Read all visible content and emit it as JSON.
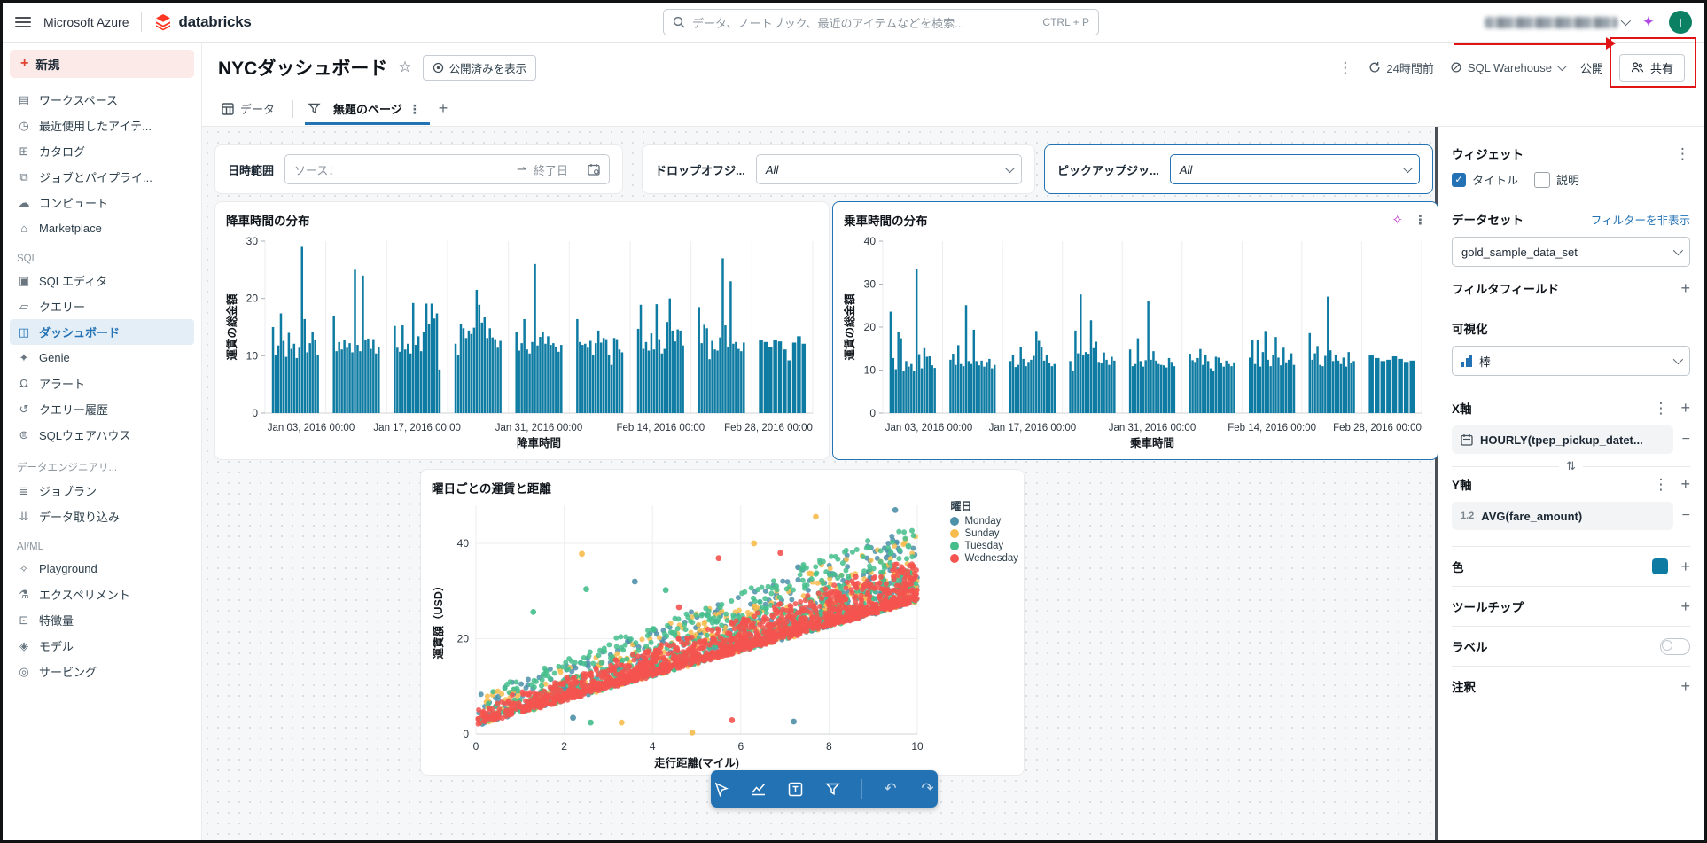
{
  "colors": {
    "accent_blue": "#2272b4",
    "bar_teal": "#0e7ba2",
    "annotation_red": "#e01414",
    "brand_red": "#ff3621",
    "active_item_bg": "#e4eef7"
  },
  "topbar": {
    "azure": "Microsoft Azure",
    "brand": "databricks",
    "search_placeholder": "データ、ノートブック、最近のアイテムなどを検索...",
    "search_shortcut": "CTRL + P",
    "avatar_initial": "I"
  },
  "sidebar": {
    "new_label": "新規",
    "items": [
      {
        "name": "workspace",
        "icon": "▤",
        "label": "ワークスペース"
      },
      {
        "name": "recents",
        "icon": "◷",
        "label": "最近使用したアイテ..."
      },
      {
        "name": "catalog",
        "icon": "⊞",
        "label": "カタログ"
      },
      {
        "name": "jobs-pipelines",
        "icon": "⧉",
        "label": "ジョブとパイプライ..."
      },
      {
        "name": "compute",
        "icon": "☁",
        "label": "コンピュート"
      },
      {
        "name": "marketplace",
        "icon": "⌂",
        "label": "Marketplace"
      },
      {
        "section": "SQL"
      },
      {
        "name": "sql-editor",
        "icon": "▣",
        "label": "SQLエディタ"
      },
      {
        "name": "queries",
        "icon": "▱",
        "label": "クエリー"
      },
      {
        "name": "dashboards",
        "icon": "◫",
        "label": "ダッシュボード",
        "active": true
      },
      {
        "name": "genie",
        "icon": "✦",
        "label": "Genie"
      },
      {
        "name": "alerts",
        "icon": "Ω",
        "label": "アラート"
      },
      {
        "name": "query-history",
        "icon": "↺",
        "label": "クエリー履歴"
      },
      {
        "name": "sql-warehouse",
        "icon": "⊜",
        "label": "SQLウェアハウス"
      },
      {
        "section": "データエンジニアリ..."
      },
      {
        "name": "job-runs",
        "icon": "≣",
        "label": "ジョブラン"
      },
      {
        "name": "data-ingestion",
        "icon": "⇊",
        "label": "データ取り込み"
      },
      {
        "section": "AI/ML"
      },
      {
        "name": "playground",
        "icon": "✧",
        "label": "Playground"
      },
      {
        "name": "experiments",
        "icon": "⚗",
        "label": "エクスペリメント"
      },
      {
        "name": "features",
        "icon": "⊡",
        "label": "特徴量"
      },
      {
        "name": "models",
        "icon": "◈",
        "label": "モデル"
      },
      {
        "name": "serving",
        "icon": "◎",
        "label": "サービング"
      }
    ]
  },
  "header": {
    "title": "NYCダッシュボード",
    "published_view": "公開済みを表示",
    "refresh": "24時間前",
    "warehouse": "SQL Warehouse",
    "publish": "公開",
    "share": "共有"
  },
  "tabs": {
    "data": "データ",
    "page": "無題のページ"
  },
  "filters": [
    {
      "label": "日時範囲",
      "placeholder_start": "ソース：",
      "arrow": "⇀",
      "placeholder_end": "終了日"
    },
    {
      "label": "ドロップオフジ...",
      "value": "All"
    },
    {
      "label": "ピックアップジッ...",
      "value": "All",
      "selected": true
    }
  ],
  "toolbar": {
    "tools": [
      "select-cursor",
      "add-visualization",
      "add-textbox",
      "add-filter",
      "undo",
      "redo"
    ],
    "undo_glyph": "↶",
    "redo_glyph": "↷"
  },
  "panel": {
    "widget_title": "ウィジェット",
    "title_checkbox": "タイトル",
    "desc_checkbox": "説明",
    "dataset_label": "データセット",
    "hide_filters_link": "フィルターを非表示",
    "dataset_value": "gold_sample_data_set",
    "filter_fields_label": "フィルタフィールド",
    "viz_label": "可視化",
    "viz_value": "棒",
    "x_axis_label": "X軸",
    "x_field": "HOURLY(tpep_pickup_datet...",
    "y_axis_label": "Y軸",
    "y_field_prefix": "1.2",
    "y_field": "AVG(fare_amount)",
    "color_label": "色",
    "color_swatch": "#0e7ba2",
    "tooltip_label": "ツールチップ",
    "labels_label": "ラベル",
    "annotation_label": "注釈"
  },
  "chart_data": [
    {
      "type": "bar",
      "title": "降車時間の分布",
      "xlabel": "降車時間",
      "ylabel": "運賃の総金額",
      "ylim": [
        0,
        30
      ],
      "y_ticks": [
        0,
        10,
        20,
        30
      ],
      "grid": "vertical",
      "bar_color": "#0e7ba2",
      "x_ticks": [
        "Jan 03, 2016 00:00",
        "Jan 17, 2016 00:00",
        "Jan 31, 2016 00:00",
        "Feb 14, 2016 00:00",
        "Feb 28, 2016 00:00"
      ],
      "clusters": [
        [
          15,
          10.2,
          11.8,
          17.4,
          12.6,
          9.8,
          14,
          11.2,
          12.1,
          9.6,
          11.4,
          29,
          16.4,
          10.6,
          12.2,
          14.2,
          12.8,
          10.1
        ],
        [
          16.9,
          10.8,
          12.4,
          11.1,
          12.7,
          11.4,
          12.2,
          10.6,
          25,
          11.9,
          10.8,
          24,
          12.8,
          13,
          11.2,
          12.9,
          10.4,
          11.6
        ],
        [
          15.2,
          11.4,
          10.7,
          15.3,
          11.1,
          12.1,
          10.4,
          19.2,
          11.9,
          13.4,
          10.8,
          14.1,
          19.1,
          15.5,
          19.1,
          16.5,
          17.4,
          7.6
        ],
        [
          12.1,
          10.1,
          15.6,
          14.8,
          13.1,
          14.4,
          13.8,
          14.9,
          21.5,
          18.9,
          15.8,
          16.7,
          13.1,
          14.8,
          13.2,
          12.9,
          11.4,
          12.6
        ],
        [
          14.1,
          10.9,
          12.2,
          16.4,
          11.1,
          10.4,
          12.4,
          26,
          11.8,
          13.3,
          14.1,
          12.1,
          13.4,
          11.9,
          12.2,
          11.6,
          10.7,
          11.9
        ],
        [
          16.4,
          12.4,
          11.9,
          12.1,
          11.4,
          12.6,
          10.1,
          12.2,
          14.4,
          12.3,
          13.1,
          12.9,
          10.2,
          8.4,
          13.1,
          12.9,
          11.1,
          10.6
        ],
        [
          14.7,
          18.9,
          11.2,
          12.4,
          10.9,
          13.9,
          11.1,
          19,
          12.9,
          10.4,
          11.2,
          15.9,
          20,
          14.4,
          12.5,
          14.6,
          14.4,
          11.8
        ],
        [
          18.5,
          12.2,
          15.4,
          14.8,
          9.4,
          12.6,
          11.1,
          10.9,
          13.2,
          27,
          15.3,
          11.6,
          23,
          12.1,
          12.4,
          11.2,
          10.8,
          12.3
        ],
        [
          12.8,
          12.4,
          11.6,
          12.7,
          12.5,
          11.1,
          9.2,
          12.3,
          13.4,
          12.1
        ]
      ]
    },
    {
      "type": "bar",
      "title": "乗車時間の分布",
      "xlabel": "乗車時間",
      "ylabel": "運賃の総金額",
      "ylim": [
        0,
        40
      ],
      "y_ticks": [
        0,
        10,
        20,
        30,
        40
      ],
      "grid": "vertical",
      "bar_color": "#0e7ba2",
      "selected": true,
      "x_ticks": [
        "Jan 03, 2016 00:00",
        "Jan 17, 2016 00:00",
        "Jan 31, 2016 00:00",
        "Feb 14, 2016 00:00",
        "Feb 28, 2016 00:00"
      ],
      "clusters": [
        [
          23.6,
          12.8,
          10.2,
          18.9,
          17.4,
          9.9,
          12.1,
          10.8,
          11.4,
          9.8,
          33.5,
          13.7,
          10.4,
          15.1,
          13.1,
          13.2,
          11.1,
          10.5
        ],
        [
          12.4,
          13.8,
          11.2,
          15.8,
          11.4,
          10.9,
          25.1,
          12.1,
          11.4,
          19.4,
          12.1,
          11.1,
          12.2,
          10.8,
          11.9,
          12.6,
          10.4,
          11.2
        ],
        [
          12.1,
          13.4,
          10.7,
          11.2,
          15.4,
          12.6,
          10.9,
          11.9,
          12.4,
          13.3,
          19.1,
          16.8,
          15.4,
          12.2,
          13.4,
          11.6,
          10.9,
          11.4
        ],
        [
          12.1,
          9.9,
          19.2,
          13.9,
          27.6,
          13.4,
          14.2,
          13.8,
          21.6,
          15.1,
          16.6,
          11.9,
          11.6,
          14.1,
          12.4,
          11.2,
          13.1,
          12.2
        ],
        [
          14.8,
          10.9,
          11.4,
          17.4,
          12.1,
          10.8,
          12.3,
          26.1,
          12.4,
          14.4,
          12.2,
          11.4,
          11.2,
          11.1,
          10.6,
          12.8,
          11.9,
          10.9
        ],
        [
          13.8,
          12.3,
          11.9,
          12.8,
          14.9,
          11.2,
          13.4,
          12.1,
          10.4,
          9.9,
          13.1,
          12.9,
          11.6,
          10.8,
          12.2,
          11.4,
          10.9,
          11.8
        ],
        [
          12.9,
          16.9,
          11.4,
          16.9,
          10.8,
          14.2,
          19.1,
          12.4,
          10.9,
          13.6,
          17.7,
          12.9,
          11.1,
          15.2,
          11.8,
          12.4,
          13.9,
          11.2
        ],
        [
          18.6,
          12.4,
          13.9,
          15.6,
          11.2,
          10.9,
          13.3,
          27.1,
          14.6,
          12.1,
          13.6,
          12.2,
          11.4,
          12.9,
          10.8,
          14.2,
          11.6,
          12.1
        ],
        [
          13.4,
          12.8,
          12.1,
          12.4,
          13.2,
          12.6,
          11.9,
          12.2
        ]
      ]
    },
    {
      "type": "scatter",
      "title": "曜日ごとの運賃と距離",
      "xlabel": "走行距離(マイル)",
      "ylabel": "運賃額（USD）",
      "xlim": [
        0,
        10
      ],
      "ylim": [
        0,
        48
      ],
      "x_ticks": [
        0,
        2,
        4,
        6,
        8,
        10
      ],
      "y_ticks": [
        0,
        20,
        40
      ],
      "legend_title": "曜日",
      "legend_position": "right",
      "trend": {
        "intercept": 2.3,
        "slope": 2.6
      },
      "series": [
        {
          "name": "Monday",
          "color": "#4c90a9",
          "count": 600,
          "spread": 0.9,
          "seed": 11,
          "outliers": [
            [
              3.6,
              32
            ],
            [
              9.5,
              47
            ],
            [
              7.3,
              35
            ],
            [
              2.2,
              3.4
            ],
            [
              7.2,
              2.6
            ],
            [
              8.9,
              34
            ],
            [
              9.3,
              37
            ]
          ]
        },
        {
          "name": "Sunday",
          "color": "#f7bc4d",
          "count": 550,
          "spread": 0.85,
          "seed": 22,
          "outliers": [
            [
              2.4,
              37.8
            ],
            [
              7.7,
              45.6
            ],
            [
              6.3,
              40
            ],
            [
              4.9,
              0.3
            ],
            [
              3.3,
              2.4
            ],
            [
              7.6,
              33.6
            ],
            [
              9.2,
              33.5
            ]
          ]
        },
        {
          "name": "Tuesday",
          "color": "#45be8c",
          "count": 800,
          "spread": 0.95,
          "seed": 33,
          "outliers": [
            [
              9.8,
              39.4
            ],
            [
              2.5,
              30.4
            ],
            [
              1.3,
              25.6
            ],
            [
              2.6,
              2.4
            ],
            [
              4.3,
              30.2
            ],
            [
              6.8,
              31
            ],
            [
              9.4,
              38
            ]
          ]
        },
        {
          "name": "Wednesday",
          "color": "#f4534f",
          "count": 1500,
          "spread": 0.5,
          "seed": 44,
          "outliers": [
            [
              5.5,
              36.9
            ],
            [
              6.9,
              38
            ],
            [
              5.8,
              2.9
            ],
            [
              8.6,
              33
            ],
            [
              4.6,
              26.6
            ],
            [
              9.9,
              32.5
            ]
          ]
        }
      ]
    }
  ]
}
